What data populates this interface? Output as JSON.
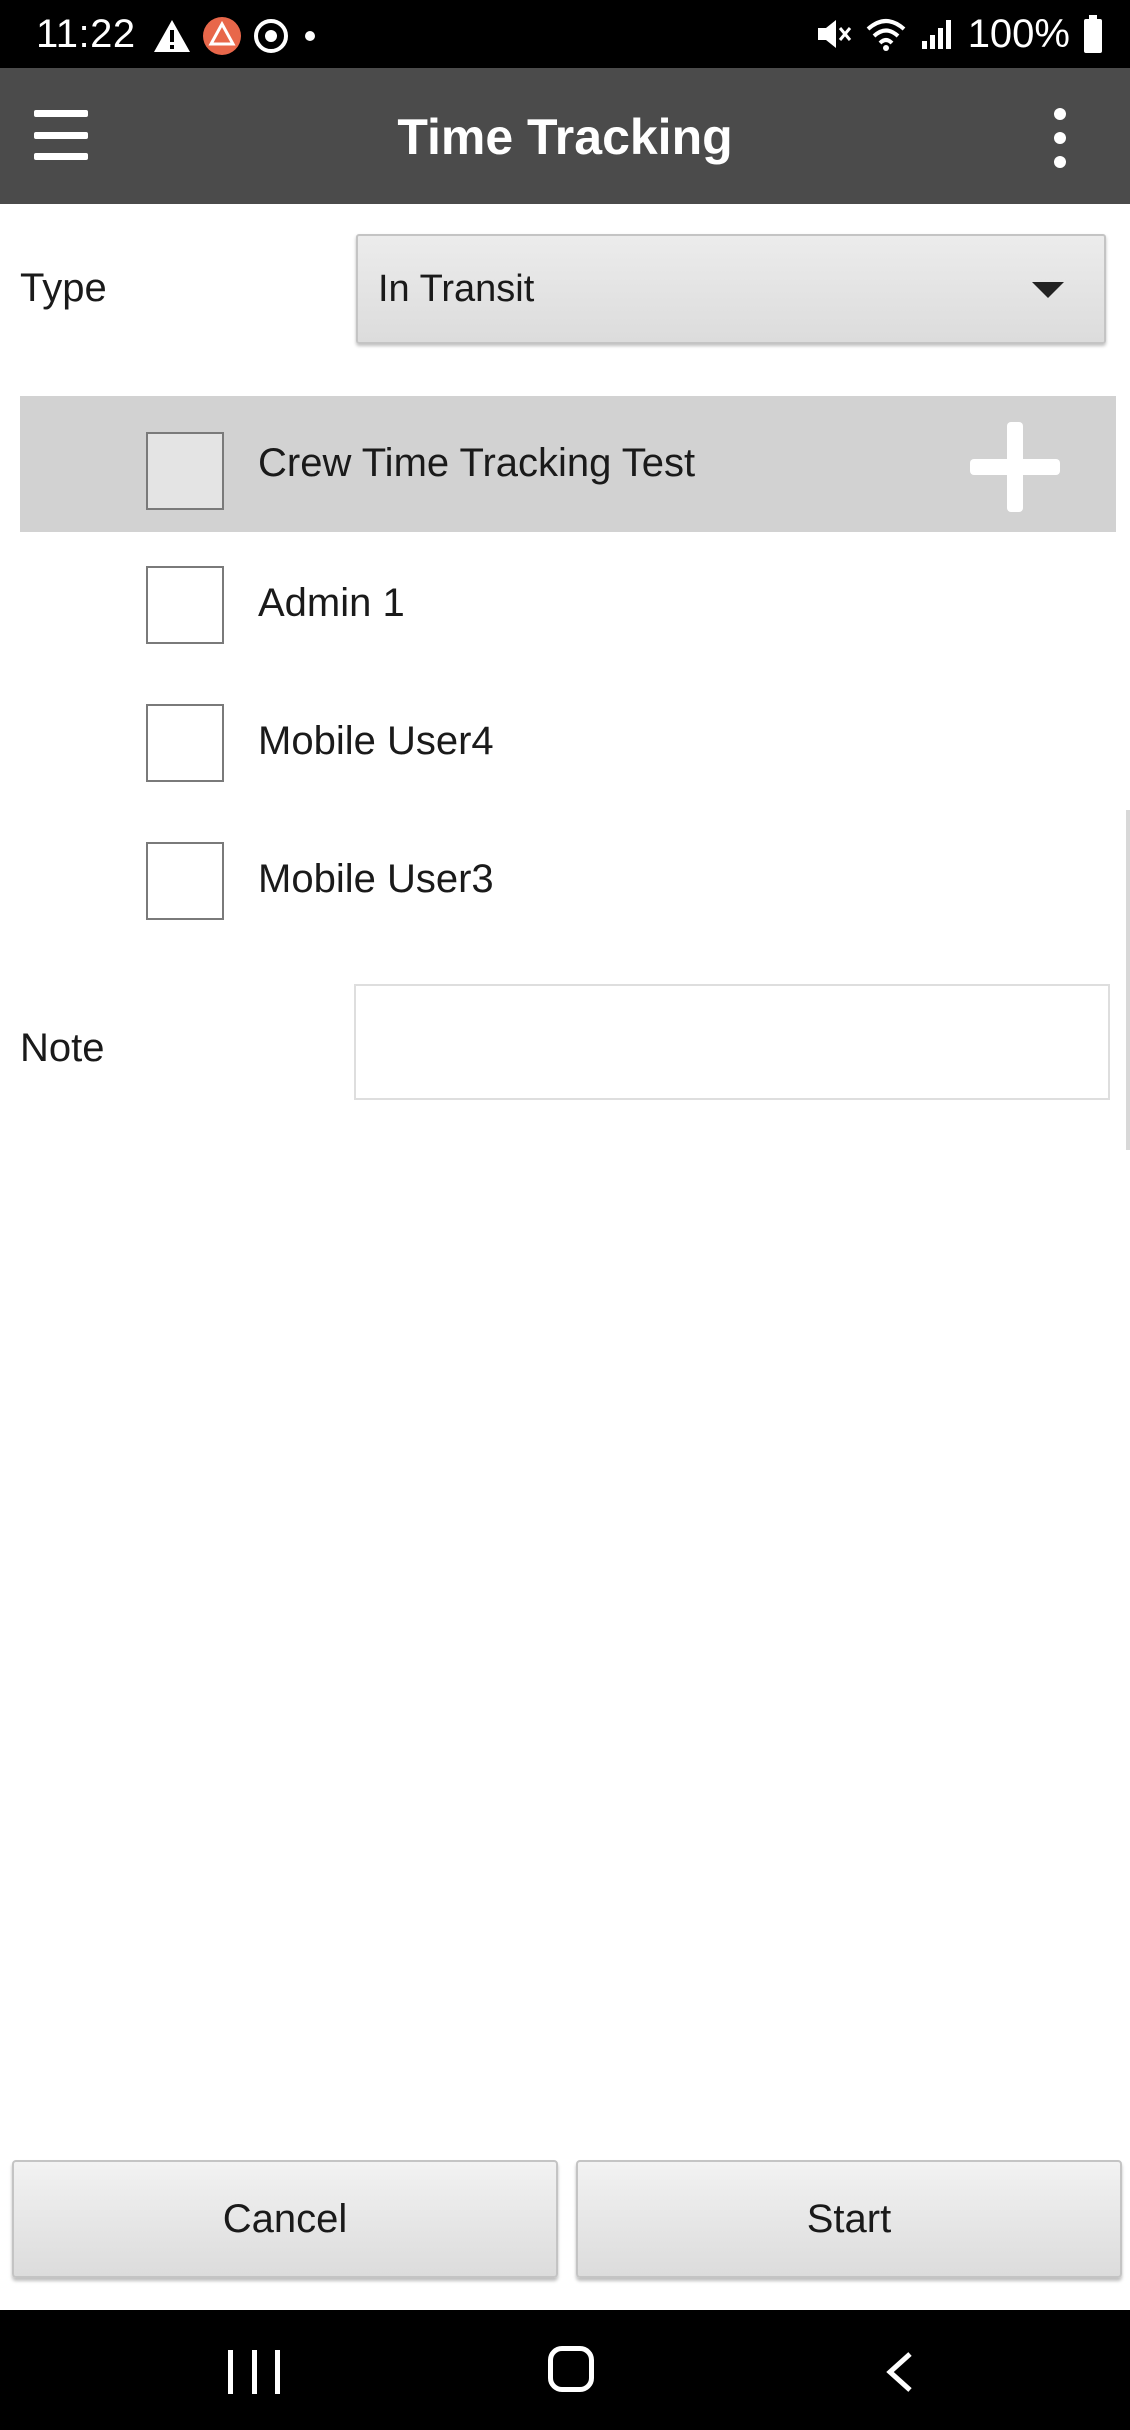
{
  "status_bar": {
    "time": "11:22",
    "battery": "100%",
    "icons": [
      "warning-icon",
      "app-notification-icon",
      "sync-icon",
      "dot-icon",
      "mute-icon",
      "wifi-icon",
      "signal-icon",
      "battery-icon"
    ]
  },
  "app_bar": {
    "title": "Time Tracking",
    "menu_icon": "hamburger-menu-icon",
    "more_icon": "more-vert-icon"
  },
  "form": {
    "type_label": "Type",
    "type_value": "In Transit",
    "note_label": "Note",
    "note_value": "",
    "note_placeholder": ""
  },
  "crew": {
    "title": "Crew Time Tracking Test",
    "checked": false,
    "members": [
      {
        "name": "Admin 1",
        "checked": false
      },
      {
        "name": "Mobile User4",
        "checked": false
      },
      {
        "name": "Mobile User3",
        "checked": false
      }
    ]
  },
  "actions": {
    "cancel_label": "Cancel",
    "start_label": "Start"
  },
  "colors": {
    "app_bar": "#4b4b4b",
    "crew_header": "#d2d2d2",
    "system_bars": "#000000"
  }
}
